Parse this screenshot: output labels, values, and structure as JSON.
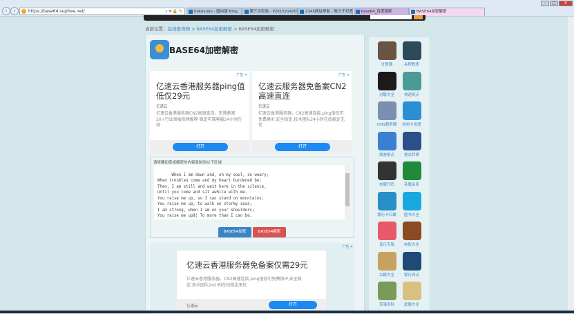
{
  "browser": {
    "url": "https://base64.supfree.net/",
    "tabs": [
      {
        "label": "bokeyuan - 国内版 Bing",
        "color": "#b8cde0"
      },
      {
        "label": "第三次实验 - P20152142003...",
        "color": "#b8cde0"
      },
      {
        "label": "2345网址导航 - 致力于打造百...",
        "color": "#b8cde0"
      },
      {
        "label": "base64_百度搜索",
        "color": "#c9b6e0"
      },
      {
        "label": "BASE64加密解密",
        "color": "#f4d8f0"
      }
    ]
  },
  "breadcrumb": {
    "prefix": "当前位置：",
    "home": "在线查询网",
    "sep": " > ",
    "section": "BASE64加密解密",
    "current": "BASE64加密解密"
  },
  "page": {
    "title": "BASE64加密解密"
  },
  "ads": [
    {
      "mark": "广告 ✕",
      "title": "亿速云香港服务器ping值低仅29元",
      "source": "亿速云",
      "desc": "亿速云香港服务器CN2高速直连，无需备案20+行业领袖视频推荐 稳定可靠客服24小时在线",
      "button": "打开"
    },
    {
      "mark": "广告 ✕",
      "title": "亿速云服务器免备案CN2高速直连",
      "source": "亿速云",
      "desc": "亿速云香港服务器，CN2高速连接,ping值低可免费换IP,安全稳定,技术团队24小时在线稳定无忧",
      "button": "打开"
    }
  ],
  "converter": {
    "label": "请将要加密或解密的内容复制到以下区域",
    "text": "When I am down and, oh my soul, so weary;\nWhen troubles come and my heart burdened be;\nThen, I am still and wait here in the silence,\nUntil you come and sit awhile with me.\nYou raise me up, so I can stand on mountains;\nYou raise me up, to walk on stormy seas;\nI am strong, when I am on your shoulders;\nYou raise me upâ¦ To more than I can be.\nYou raise me up, so I can stand on mountains;",
    "encode": "BASE64加密",
    "decode": "BASE64解密"
  },
  "ad_bottom": {
    "mark": "广告 ✕",
    "title": "亿速云香港服务器免备案仅需29元",
    "desc": "亿速云香港服务器，CN2高速连接,ping值低可免费换IP,安全稳定,技术团队24小时在线稳定无忧",
    "source": "亿速云",
    "button": "打开"
  },
  "sidebar": [
    {
      "label": "计算器",
      "icon": "calculator-icon",
      "color": "#6b5344"
    },
    {
      "label": "关税税率",
      "icon": "tariff-icon",
      "color": "#2c4a5a"
    },
    {
      "label": "对联大全",
      "icon": "couplet-icon",
      "color": "#1a1a1a"
    },
    {
      "label": "快递网点",
      "icon": "delivery-icon",
      "color": "#4a9a98"
    },
    {
      "label": "DNS服务器",
      "icon": "dns-icon",
      "color": "#7a90b0"
    },
    {
      "label": "信用卡进度",
      "icon": "credit-card-icon",
      "color": "#2b8fd6"
    },
    {
      "label": "旅游景点",
      "icon": "map-pin-icon",
      "color": "#3b7fd0"
    },
    {
      "label": "格式转换",
      "icon": "document-icon",
      "color": "#2a4f8a"
    },
    {
      "label": "衣服尺码",
      "icon": "suit-icon",
      "color": "#333333"
    },
    {
      "label": "亲属关系",
      "icon": "family-icon",
      "color": "#1f8a3a"
    },
    {
      "label": "银行卡归属",
      "icon": "bank-card-icon",
      "color": "#2a8ec8"
    },
    {
      "label": "图书大全",
      "icon": "book-icon",
      "color": "#18a8e0"
    },
    {
      "label": "音乐专辑",
      "icon": "headphones-icon",
      "color": "#e85a6a"
    },
    {
      "label": "电影大全",
      "icon": "film-icon",
      "color": "#8a4a22"
    },
    {
      "label": "古籍大全",
      "icon": "ancient-book-icon",
      "color": "#c8a060"
    },
    {
      "label": "银行网点",
      "icon": "bank-icon",
      "color": "#1f4a78"
    },
    {
      "label": "军事百科",
      "icon": "military-icon",
      "color": "#7a9a5a"
    },
    {
      "label": "武器大全",
      "icon": "tank-icon",
      "color": "#d8c080"
    }
  ]
}
